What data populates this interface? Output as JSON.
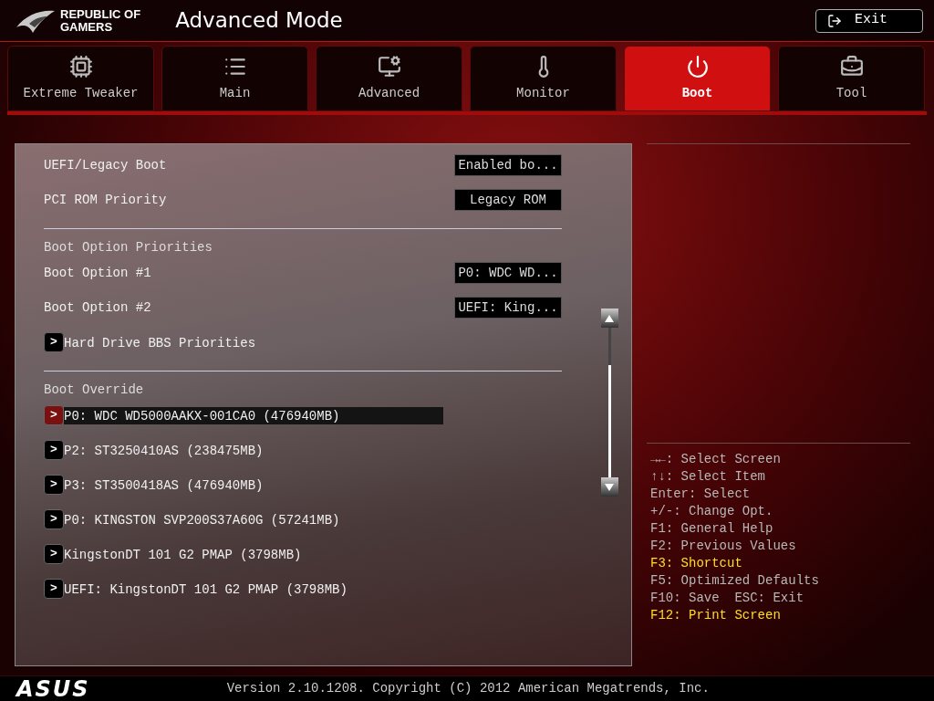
{
  "header": {
    "brand_line_1": "REPUBLIC OF",
    "brand_line_2": "GAMERS",
    "title": "Advanced Mode",
    "exit_button": "Exit"
  },
  "tabs": [
    {
      "label": "Extreme Tweaker",
      "selected": false
    },
    {
      "label": "Main",
      "selected": false
    },
    {
      "label": "Advanced",
      "selected": false
    },
    {
      "label": "Monitor",
      "selected": false
    },
    {
      "label": "Boot",
      "selected": true
    },
    {
      "label": "Tool",
      "selected": false
    }
  ],
  "settings": [
    {
      "kind": "option",
      "label": "UEFI/Legacy Boot",
      "value": "Enabled bo..."
    },
    {
      "kind": "option",
      "label": "PCI ROM Priority",
      "value": "Legacy ROM"
    },
    {
      "kind": "divider"
    },
    {
      "kind": "heading",
      "label": "Boot Option Priorities"
    },
    {
      "kind": "option",
      "label": "Boot Option #1",
      "value": "P0: WDC WD..."
    },
    {
      "kind": "option",
      "label": "Boot Option #2",
      "value": "UEFI: King..."
    },
    {
      "kind": "submenu",
      "label": "Hard Drive BBS Priorities",
      "arrow": ">",
      "selected": false
    },
    {
      "kind": "divider"
    },
    {
      "kind": "heading",
      "label": "Boot Override"
    },
    {
      "kind": "submenu",
      "label": "P0: WDC WD5000AAKX-001CA0  (476940MB)",
      "arrow": ">",
      "selected": true
    },
    {
      "kind": "submenu",
      "label": "P2: ST3250410AS  (238475MB)",
      "arrow": ">",
      "selected": false
    },
    {
      "kind": "submenu",
      "label": "P3: ST3500418AS  (476940MB)",
      "arrow": ">",
      "selected": false
    },
    {
      "kind": "submenu",
      "label": "P0: KINGSTON SVP200S37A60G  (57241MB)",
      "arrow": ">",
      "selected": false
    },
    {
      "kind": "submenu",
      "label": "KingstonDT 101 G2 PMAP  (3798MB)",
      "arrow": ">",
      "selected": false
    },
    {
      "kind": "submenu",
      "label": "UEFI: KingstonDT 101 G2 PMAP (3798MB)",
      "arrow": ">",
      "selected": false
    }
  ],
  "help": [
    {
      "text": "→←: Select Screen",
      "highlighted": false
    },
    {
      "text": "↑↓: Select Item",
      "highlighted": false
    },
    {
      "text": "Enter: Select",
      "highlighted": false
    },
    {
      "text": "+/-: Change Opt.",
      "highlighted": false
    },
    {
      "text": "F1: General Help",
      "highlighted": false
    },
    {
      "text": "F2: Previous Values",
      "highlighted": false
    },
    {
      "text": "F3: Shortcut",
      "highlighted": true
    },
    {
      "text": "F5: Optimized Defaults",
      "highlighted": false
    },
    {
      "text": "F10: Save  ESC: Exit",
      "highlighted": false
    },
    {
      "text": "F12: Print Screen",
      "highlighted": true
    }
  ],
  "footer": {
    "logo": "ASUS",
    "version": "Version 2.10.1208. Copyright (C) 2012 American Megatrends, Inc."
  }
}
